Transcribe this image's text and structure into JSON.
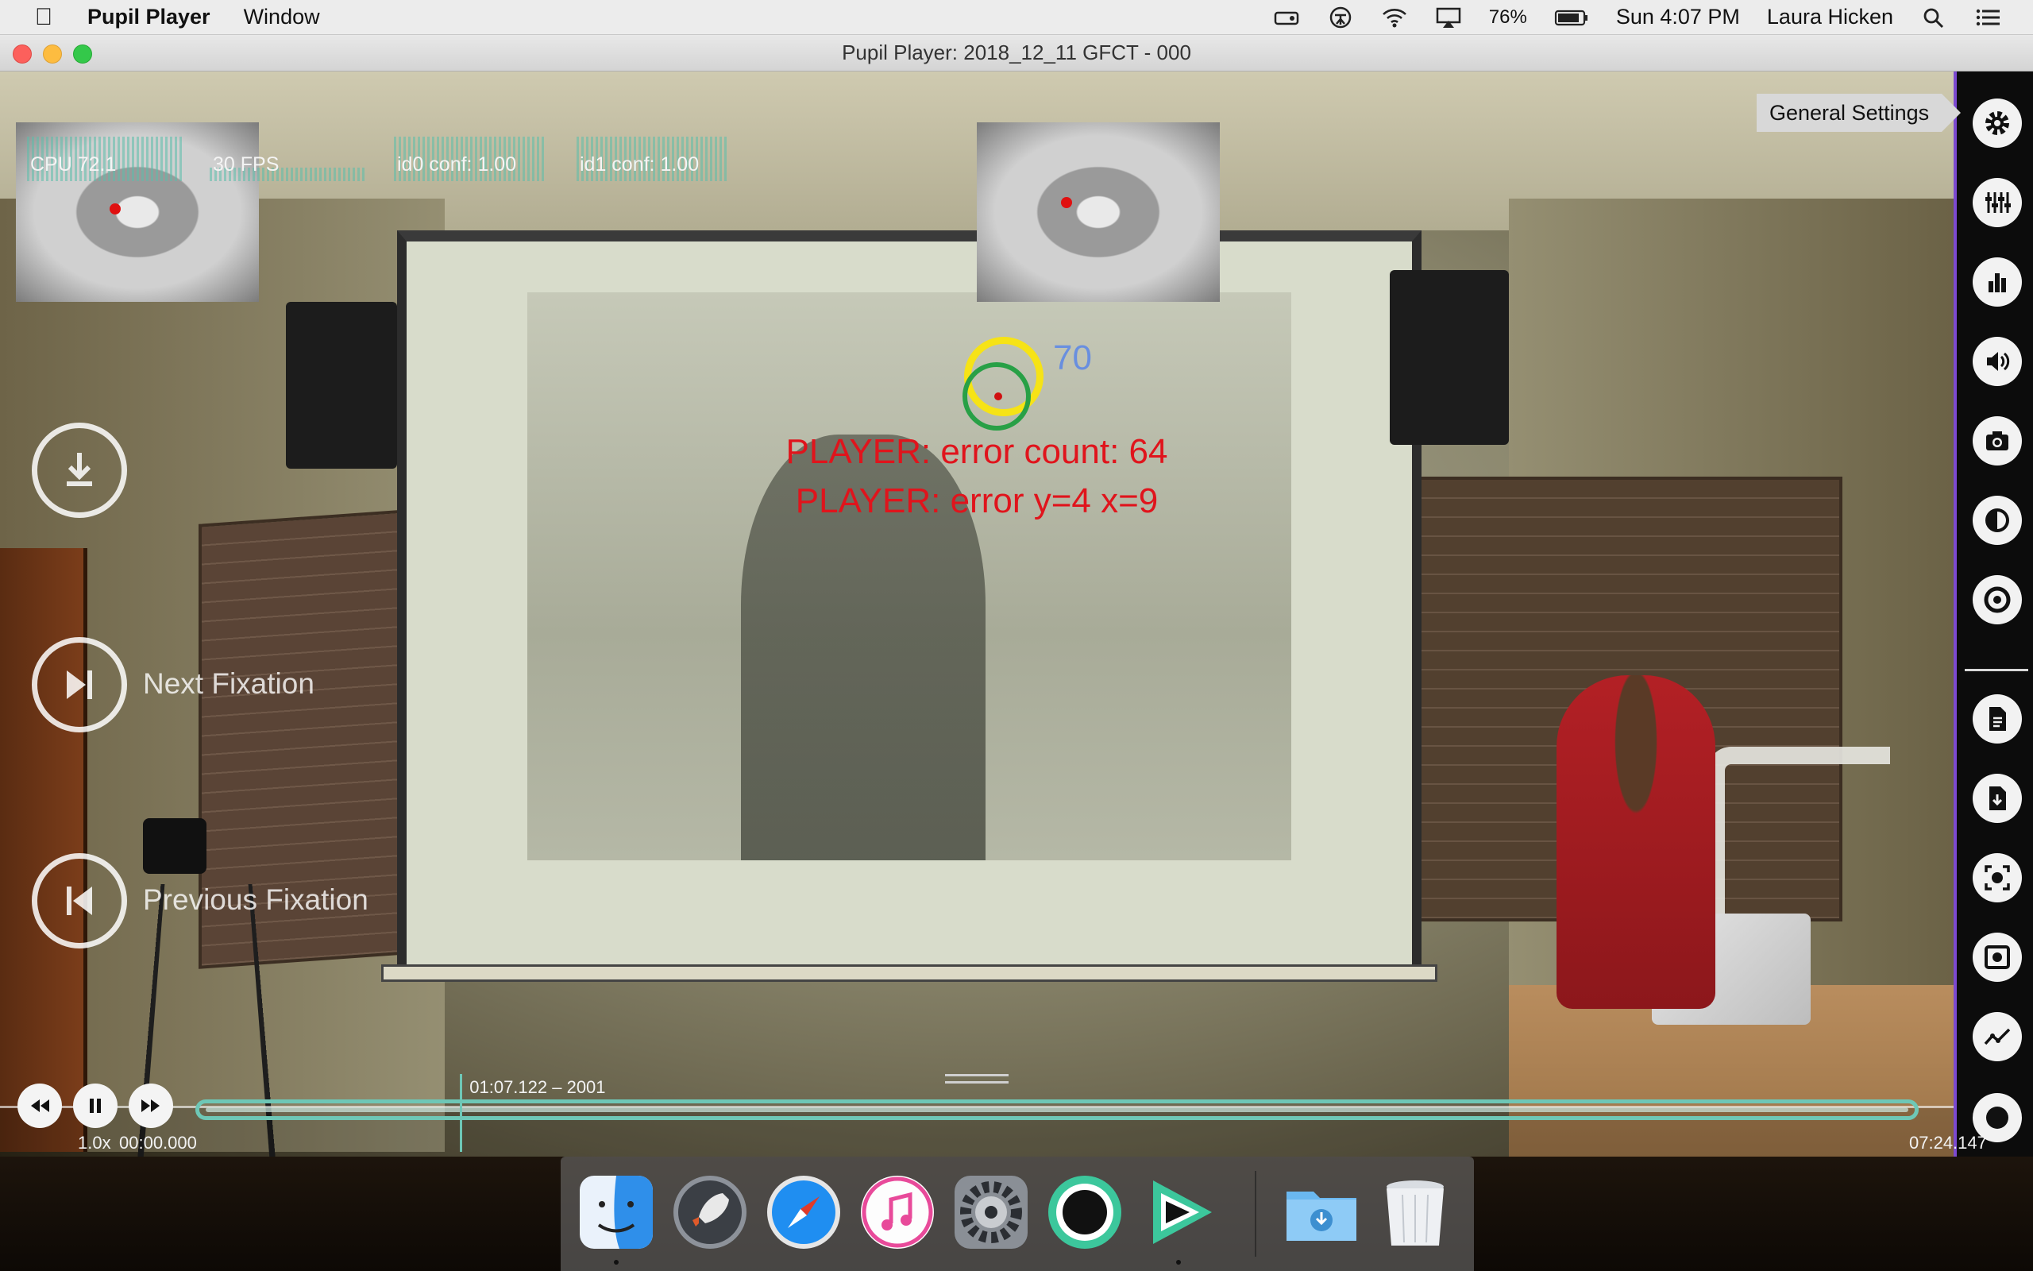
{
  "menubar": {
    "app_name": "Pupil Player",
    "menus": [
      "Window"
    ],
    "battery": "76%",
    "clock": "Sun 4:07 PM",
    "user": "Laura Hicken"
  },
  "window": {
    "title": "Pupil Player: 2018_12_11 GFCT - 000"
  },
  "hud": {
    "cpu": "CPU 72.1",
    "fps": "30 FPS",
    "id0": "id0 conf: 1.00",
    "id1": "id1 conf: 1.00"
  },
  "overlay": {
    "fixation_id": "70",
    "error_line_1": "PLAYER: error count: 64",
    "error_line_2": "PLAYER: error y=4 x=9"
  },
  "actions": {
    "next_fixation": "Next Fixation",
    "previous_fixation": "Previous Fixation"
  },
  "sidebar": {
    "tooltip": "General Settings",
    "buttons": [
      "gear-icon",
      "plugins-icon",
      "bar-chart-icon",
      "audio-icon",
      "camera-icon",
      "eye-icon",
      "target-icon",
      "document-icon",
      "export-document-icon",
      "screen-capture-icon",
      "recording-icon",
      "line-chart-icon",
      "record-icon"
    ]
  },
  "timeline": {
    "playhead_label": "01:07.122 – 2001",
    "speed": "1.0x",
    "start_time": "00:00.000",
    "end_time": "07:24.147",
    "progress": 0.151
  },
  "dock": {
    "apps": [
      "finder-icon",
      "launchpad-icon",
      "safari-icon",
      "itunes-icon",
      "system-preferences-icon",
      "pupil-capture-icon",
      "pupil-player-icon",
      "downloads-folder-icon",
      "trash-icon"
    ]
  },
  "colors": {
    "accent": "#6ec7b6",
    "error_text": "#e0141c",
    "gaze_yellow": "#f6e316",
    "gaze_green": "#28a046",
    "fixation_blue": "#5a86e8",
    "sidebar_border": "#7c4ad0"
  }
}
